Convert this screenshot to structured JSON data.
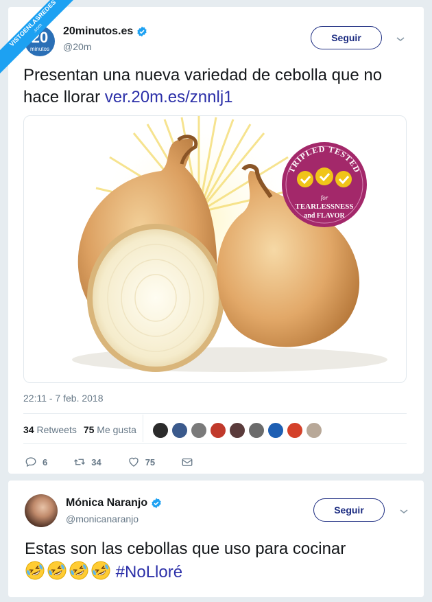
{
  "watermark": {
    "line1": "VISTOENLASREDES",
    "line2": ".com"
  },
  "tweet1": {
    "avatar": {
      "number": "20",
      "word": "minutos"
    },
    "author_name": "20minutos.es",
    "author_handle": "@20m",
    "follow_label": "Seguir",
    "text": "Presentan una nueva variedad de cebolla que no hace llorar",
    "link": "ver.20m.es/znnlj1",
    "media": {
      "badge_top": "TRIPLED TESTED",
      "badge_for": "for",
      "badge_line1": "TEARLESSNESS",
      "badge_line2": "and FLAVOR"
    },
    "timestamp": "22:11 - 7 feb. 2018",
    "retweets_count": "34",
    "retweets_label": "Retweets",
    "likes_count": "75",
    "likes_label": "Me gusta",
    "actions": {
      "replies": "6",
      "retweets": "34",
      "likes": "75"
    },
    "liker_colors": [
      "#2b2b2b",
      "#3b5a8c",
      "#7a7a7a",
      "#c0392b",
      "#5a3b3b",
      "#6b6b6b",
      "#1e5fb3",
      "#d4412a",
      "#b8a898"
    ]
  },
  "tweet2": {
    "author_name": "Mónica Naranjo",
    "author_handle": "@monicanaranjo",
    "follow_label": "Seguir",
    "text": "Estas son las cebollas que uso para cocinar",
    "emoji_count": 4,
    "hashtag": "#NoLloré"
  },
  "colors": {
    "verified": "#1da1f2",
    "link": "#2b2fa8",
    "follow_border": "#1b2b80"
  }
}
